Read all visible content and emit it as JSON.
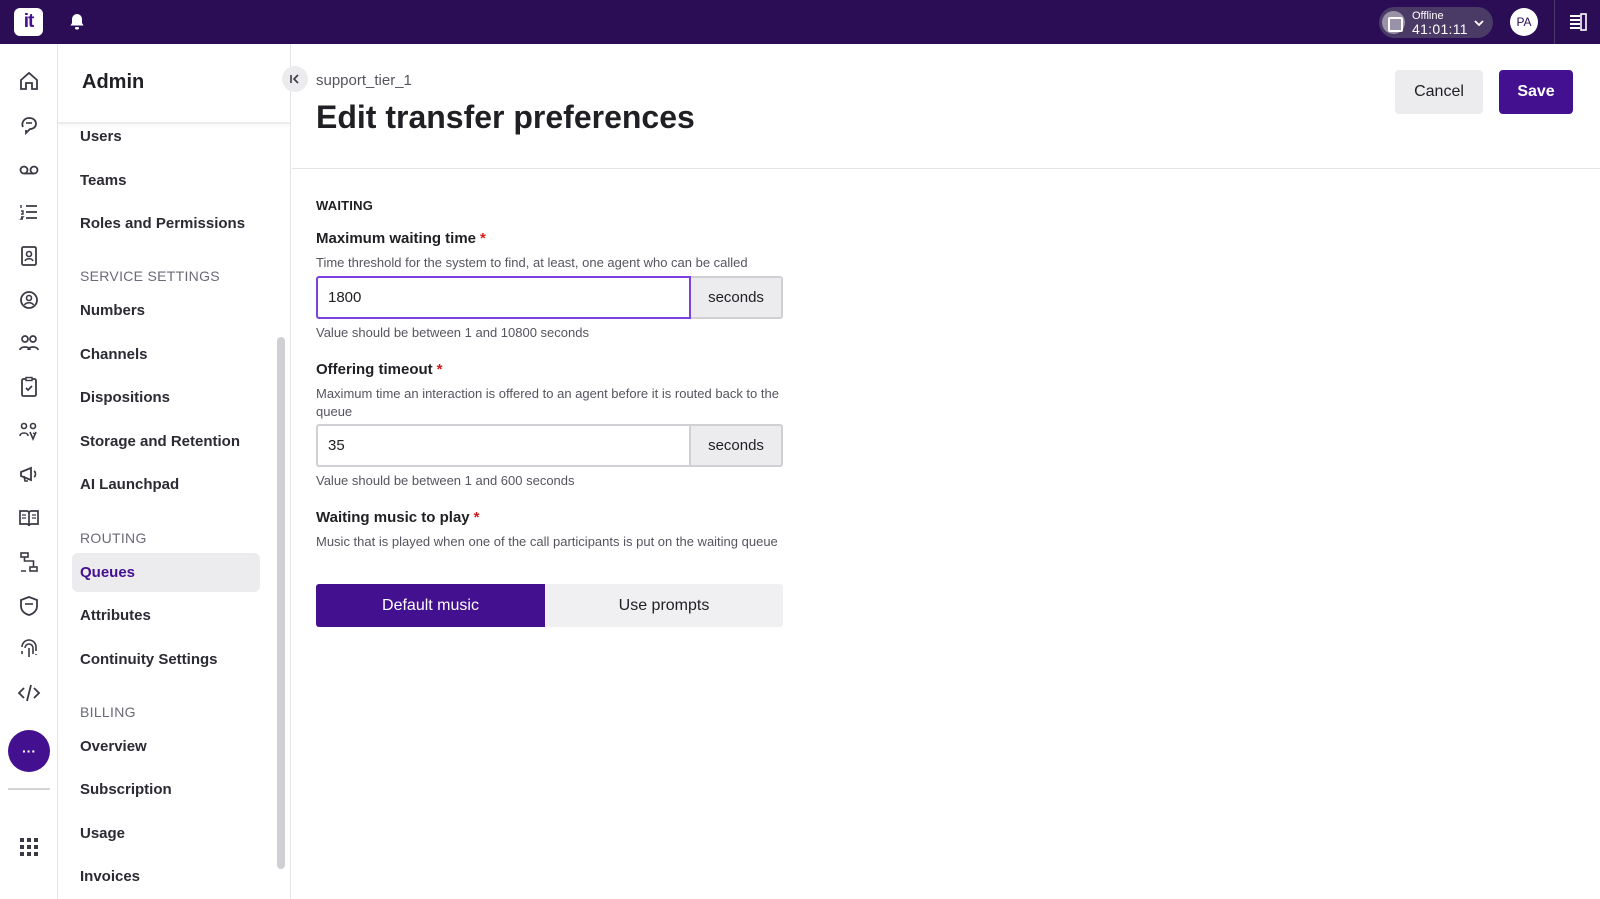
{
  "topbar": {
    "logo_text": "it",
    "status_label": "Offline",
    "status_timer": "41:01:11",
    "avatar_initials": "PA"
  },
  "rail": {
    "icons": [
      "home-icon",
      "conversations-icon",
      "voicemail-icon",
      "task-list-icon",
      "contacts-icon",
      "agent-status-icon",
      "teams-icon",
      "clipboard-icon",
      "supervisor-icon",
      "campaigns-icon",
      "knowledge-base-icon",
      "flows-icon",
      "security-icon",
      "fingerprint-icon",
      "developer-icon"
    ],
    "more_label": "···",
    "apps_icon": "apps-grid-icon"
  },
  "sidebar": {
    "title": "Admin",
    "top_items": [
      {
        "label": "Users"
      },
      {
        "label": "Teams"
      },
      {
        "label": "Roles and Permissions"
      }
    ],
    "service_settings_label": "SERVICE SETTINGS",
    "service_items": [
      {
        "label": "Numbers"
      },
      {
        "label": "Channels"
      },
      {
        "label": "Dispositions"
      },
      {
        "label": "Storage and Retention"
      },
      {
        "label": "AI Launchpad"
      }
    ],
    "routing_label": "ROUTING",
    "routing_items": [
      {
        "label": "Queues",
        "active": true
      },
      {
        "label": "Attributes"
      },
      {
        "label": "Continuity Settings"
      }
    ],
    "billing_label": "BILLING",
    "billing_items": [
      {
        "label": "Overview"
      },
      {
        "label": "Subscription"
      },
      {
        "label": "Usage"
      },
      {
        "label": "Invoices"
      }
    ]
  },
  "main": {
    "breadcrumb": "support_tier_1",
    "title": "Edit transfer preferences",
    "cancel_label": "Cancel",
    "save_label": "Save",
    "section_label": "WAITING",
    "max_wait": {
      "label": "Maximum waiting time",
      "required": "*",
      "description": "Time threshold for the system to find, at least, one agent who can be called",
      "value": "1800",
      "unit": "seconds",
      "hint": "Value should be between 1 and 10800 seconds"
    },
    "offering_timeout": {
      "label": "Offering timeout",
      "required": "*",
      "description": "Maximum time an interaction is offered to an agent before it is routed back to the queue",
      "value": "35",
      "unit": "seconds",
      "hint": "Value should be between 1 and 600 seconds"
    },
    "waiting_music": {
      "label": "Waiting music to play",
      "required": "*",
      "description": "Music that is played when one of the call participants is put on the waiting queue",
      "options": [
        "Default music",
        "Use prompts"
      ],
      "selected": "Default music"
    }
  },
  "colors": {
    "topbar": "#2b0d56",
    "accent": "#43108f",
    "focus": "#7c3fe0",
    "required": "#d61a1a"
  }
}
